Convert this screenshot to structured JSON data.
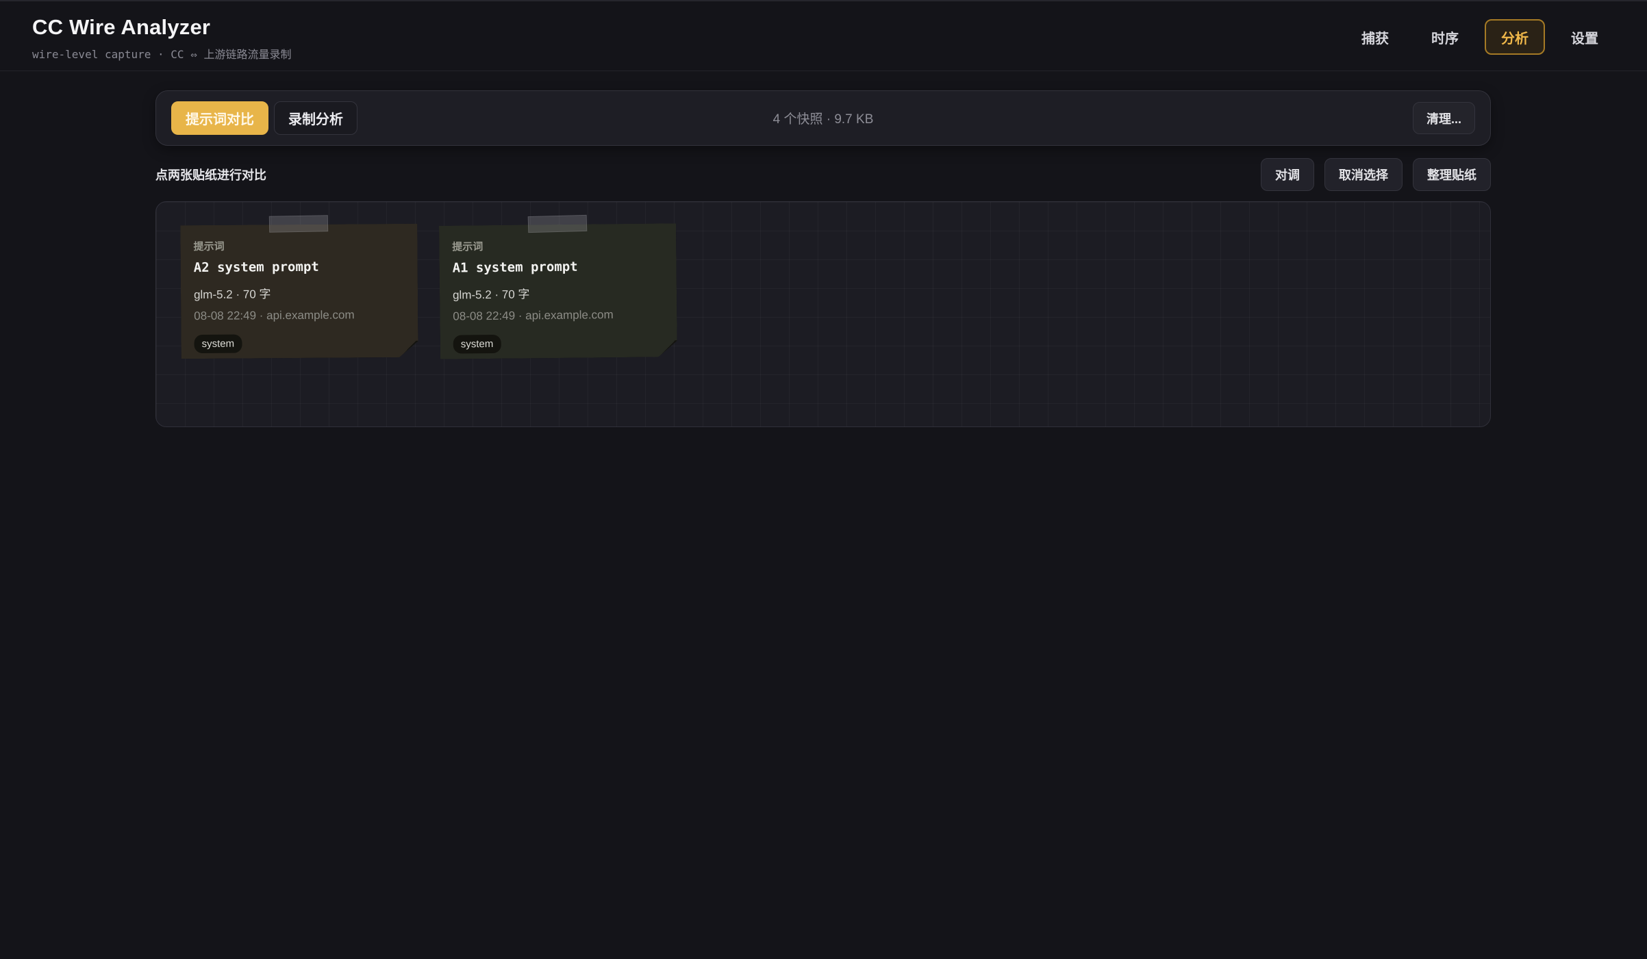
{
  "header": {
    "title": "CC Wire Analyzer",
    "subtitle": "wire-level capture · CC ⇔ 上游链路流量录制",
    "nav": [
      {
        "label": "捕获"
      },
      {
        "label": "时序"
      },
      {
        "label": "分析",
        "active": true
      },
      {
        "label": "设置"
      }
    ]
  },
  "toolbar": {
    "tabs": [
      {
        "label": "提示词对比",
        "active": true
      },
      {
        "label": "录制分析"
      }
    ],
    "summary": "4 个快照 · 9.7 KB",
    "clean_label": "清理..."
  },
  "board_header": {
    "hint": "点两张贴纸进行对比",
    "actions": [
      "对调",
      "取消选择",
      "整理贴纸"
    ]
  },
  "notes": [
    {
      "kind": "提示词",
      "title": "A2 system prompt",
      "model": "glm-5.2 · 70 字",
      "meta": "08-08 22:49 · api.example.com",
      "tag": "system",
      "color": "#2e2921"
    },
    {
      "kind": "提示词",
      "title": "A1 system prompt",
      "model": "glm-5.2 · 70 字",
      "meta": "08-08 22:49 · api.example.com",
      "tag": "system",
      "color": "#272a22"
    }
  ],
  "colors": {
    "accent": "#e8b549",
    "background": "#141419"
  }
}
